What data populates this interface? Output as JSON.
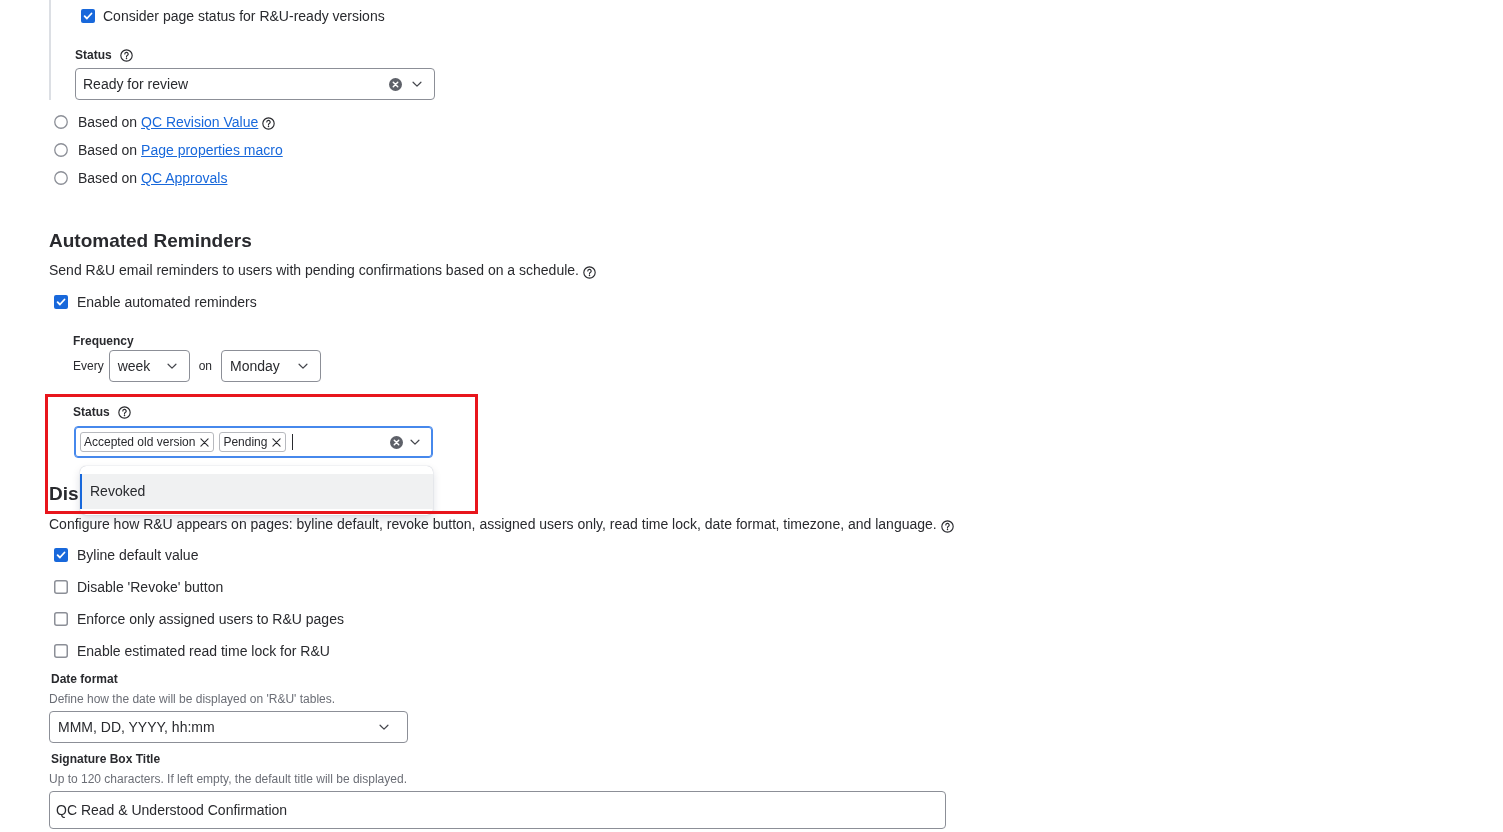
{
  "page_status": {
    "checkbox": {
      "label": "Consider page status for R&U-ready versions",
      "checked": true
    },
    "status": {
      "label": "Status",
      "help": true,
      "value": "Ready for review"
    }
  },
  "source_options": [
    {
      "prefix": "Based on",
      "link": "QC Revision Value",
      "help": true,
      "selected": false
    },
    {
      "prefix": "Based on",
      "link": "Page properties macro",
      "help": false,
      "selected": false
    },
    {
      "prefix": "Based on",
      "link": "QC Approvals",
      "help": false,
      "selected": false
    }
  ],
  "automated_reminders": {
    "title": "Automated Reminders",
    "description": "Send R&U email reminders to users with pending confirmations based on a schedule.",
    "description_help": true,
    "checkbox": {
      "label": "Enable automated reminders",
      "checked": true
    },
    "frequency": {
      "label": "Frequency",
      "every_text": "Every",
      "period": "week",
      "on_text": "on",
      "day": "Monday"
    },
    "status": {
      "label": "Status",
      "help": true,
      "focused": true,
      "highlighted": true,
      "tags": [
        {
          "label": "Accepted old version"
        },
        {
          "label": "Pending"
        }
      ],
      "options": [
        {
          "label": "Revoked",
          "selected": true
        }
      ]
    }
  },
  "display": {
    "title": "Dis",
    "description": "Configure how R&U appears on pages: byline default, revoke button, assigned users only, read time lock, date format, timezone, and language.",
    "description_help": true,
    "checkboxes": [
      {
        "label": "Byline default value",
        "checked": true
      },
      {
        "label": "Disable 'Revoke' button",
        "checked": false
      },
      {
        "label": "Enforce only assigned users to R&U pages",
        "checked": false
      },
      {
        "label": "Enable estimated read time lock for R&U",
        "checked": false
      }
    ],
    "date_format": {
      "label": "Date format",
      "hint": "Define how the date will be displayed on 'R&U' tables.",
      "value": "MMM, DD, YYYY, hh:mm"
    },
    "signature_title": {
      "label": "Signature Box Title",
      "hint": "Up to 120 characters. If left empty, the default title will be displayed.",
      "value": "QC Read & Understood Confirmation"
    }
  }
}
